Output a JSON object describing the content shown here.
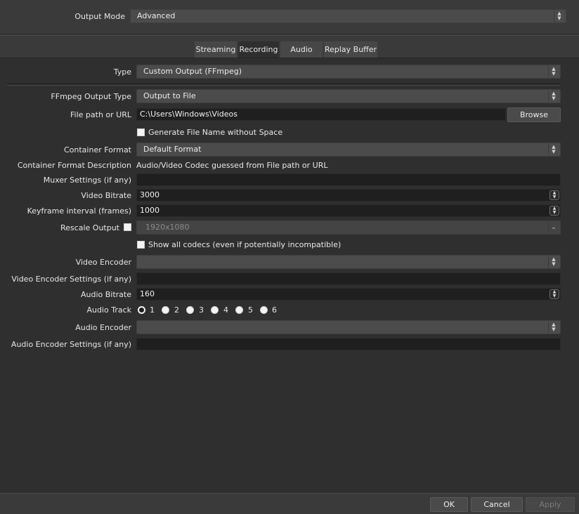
{
  "output_mode": {
    "label": "Output Mode",
    "value": "Advanced"
  },
  "tabs": [
    {
      "label": "Streaming",
      "active": false
    },
    {
      "label": "Recording",
      "active": true
    },
    {
      "label": "Audio",
      "active": false
    },
    {
      "label": "Replay Buffer",
      "active": false
    }
  ],
  "type": {
    "label": "Type",
    "value": "Custom Output (FFmpeg)"
  },
  "ffmpeg_output_type": {
    "label": "FFmpeg Output Type",
    "value": "Output to File"
  },
  "file_path": {
    "label": "File path or URL",
    "value": "C:\\Users\\Windows\\Videos",
    "browse_label": "Browse"
  },
  "generate_filename": {
    "label": "Generate File Name without Space",
    "checked": false
  },
  "container_format": {
    "label": "Container Format",
    "value": "Default Format"
  },
  "container_format_description": {
    "label": "Container Format Description",
    "value": "Audio/Video Codec guessed from File path or URL"
  },
  "muxer_settings": {
    "label": "Muxer Settings (if any)",
    "value": ""
  },
  "video_bitrate": {
    "label": "Video Bitrate",
    "value": "3000"
  },
  "keyframe_interval": {
    "label": "Keyframe interval (frames)",
    "value": "1000"
  },
  "rescale_output": {
    "label": "Rescale Output",
    "checked": false,
    "value": "1920x1080"
  },
  "show_all_codecs": {
    "label": "Show all codecs (even if potentially incompatible)",
    "checked": false
  },
  "video_encoder": {
    "label": "Video Encoder",
    "value": ""
  },
  "video_encoder_settings": {
    "label": "Video Encoder Settings (if any)",
    "value": ""
  },
  "audio_bitrate": {
    "label": "Audio Bitrate",
    "value": "160"
  },
  "audio_track": {
    "label": "Audio Track",
    "tracks": [
      "1",
      "2",
      "3",
      "4",
      "5",
      "6"
    ],
    "selected": "1"
  },
  "audio_encoder": {
    "label": "Audio Encoder",
    "value": ""
  },
  "audio_encoder_settings": {
    "label": "Audio Encoder Settings (if any)",
    "value": ""
  },
  "footer": {
    "ok_label": "OK",
    "cancel_label": "Cancel",
    "apply_label": "Apply"
  },
  "icons": {
    "combo_arrow": "updown-chevron-icon",
    "spin": "spinner-arrows-icon",
    "dropdown": "chevron-down-icon"
  },
  "colors": {
    "background": "#3a3a3a",
    "panel": "#2f2f2f",
    "field": "#1f1f1f",
    "combo": "#4b4b4b"
  }
}
